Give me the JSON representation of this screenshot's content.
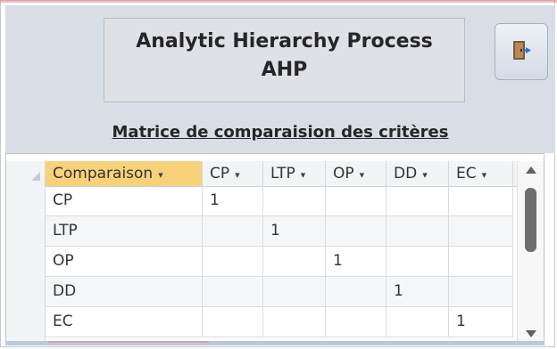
{
  "header": {
    "title_line1": "Analytic Hierarchy Process",
    "title_line2": "AHP",
    "subtitle": "Matrice de comparaision des critères",
    "exit_icon": "exit-door-icon"
  },
  "grid": {
    "columns": [
      {
        "label": "Comparaison",
        "arrow": "▾"
      },
      {
        "label": "CP",
        "arrow": "▾"
      },
      {
        "label": "LTP",
        "arrow": "▾"
      },
      {
        "label": "OP",
        "arrow": "▾"
      },
      {
        "label": "DD",
        "arrow": "▾"
      },
      {
        "label": "EC",
        "arrow": "▾"
      }
    ],
    "rows": [
      [
        "CP",
        "1",
        "",
        "",
        "",
        ""
      ],
      [
        "LTP",
        "",
        "1",
        "",
        "",
        ""
      ],
      [
        "OP",
        "",
        "",
        "1",
        "",
        ""
      ],
      [
        "DD",
        "",
        "",
        "",
        "1",
        ""
      ],
      [
        "EC",
        "",
        "",
        "",
        "",
        "1"
      ]
    ]
  },
  "colors": {
    "active_header": "#f7d27a",
    "header_bg": "#d9dde5"
  }
}
